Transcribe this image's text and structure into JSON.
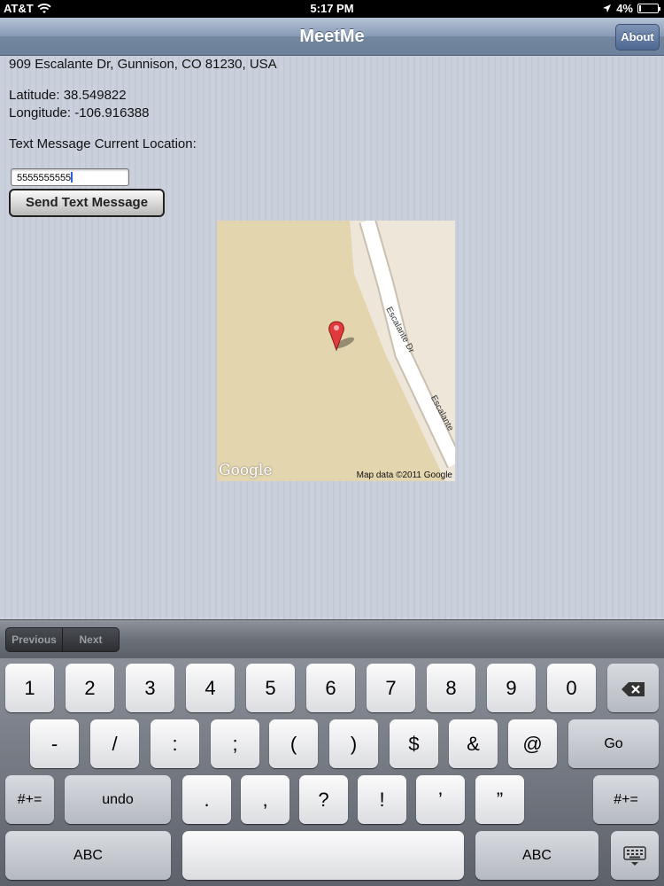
{
  "status_bar": {
    "carrier": "AT&T",
    "time": "5:17 PM",
    "battery": "4%"
  },
  "nav": {
    "title": "MeetMe",
    "about_label": "About"
  },
  "content": {
    "address": "909 Escalante Dr, Gunnison, CO 81230, USA",
    "latitude": "Latitude: 38.549822",
    "longitude": "Longitude: -106.916388",
    "text_label": "Text Message Current Location:",
    "phone_value": "5555555555",
    "send_label": "Send Text Message"
  },
  "map": {
    "road_label_1": "Escalante Dr",
    "road_label_2": "Escalante",
    "attribution": "Map data ©2011 Google",
    "logo": "Google"
  },
  "form_assistant": {
    "previous": "Previous",
    "next": "Next"
  },
  "keyboard": {
    "row1": [
      "1",
      "2",
      "3",
      "4",
      "5",
      "6",
      "7",
      "8",
      "9",
      "0"
    ],
    "row2": [
      "-",
      "/",
      ":",
      ";",
      "(",
      ")",
      "$",
      "&",
      "@"
    ],
    "go": "Go",
    "sym_left": "#+=",
    "undo": "undo",
    "row3": [
      ".",
      ",",
      "?",
      "!",
      "’",
      "”"
    ],
    "sym_right": "#+=",
    "abc_left": "ABC",
    "abc_right": "ABC"
  },
  "colors": {
    "nav_bar": "#7a8eab",
    "map_land": "#e3d6ae",
    "pin": "#e03a3a"
  },
  "icons": {
    "signal": "wifi-icon",
    "location": "location-arrow-icon",
    "delete": "backspace-icon",
    "dismiss": "keyboard-dismiss-icon",
    "pin": "map-pin-icon"
  }
}
